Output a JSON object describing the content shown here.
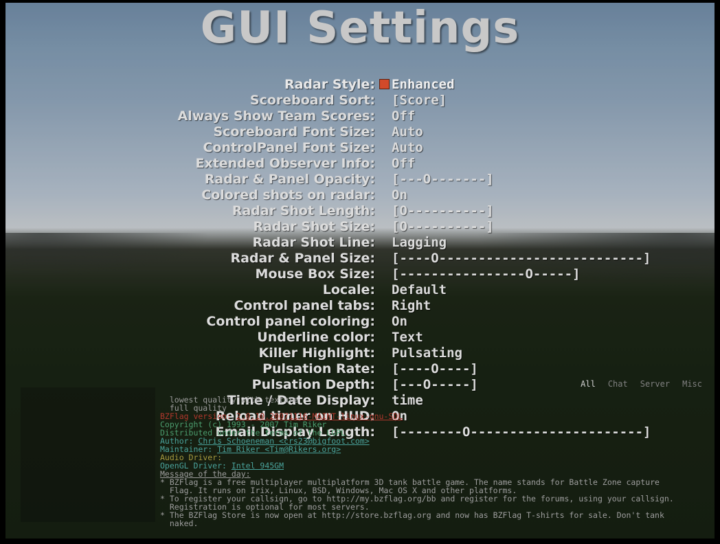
{
  "title": "GUI Settings",
  "menu": [
    {
      "label": "Radar Style:",
      "value": "Enhanced",
      "selected": true
    },
    {
      "label": "Scoreboard Sort:",
      "value": "[Score]"
    },
    {
      "label": "Always Show Team Scores:",
      "value": "Off"
    },
    {
      "label": "Scoreboard Font Size:",
      "value": "Auto"
    },
    {
      "label": "ControlPanel Font Size:",
      "value": "Auto"
    },
    {
      "label": "Extended Observer Info:",
      "value": "Off"
    },
    {
      "label": "Radar & Panel Opacity:",
      "value": "[---O-------]"
    },
    {
      "label": "Colored shots on radar:",
      "value": "On"
    },
    {
      "label": "Radar Shot Length:",
      "value": "[O----------]"
    },
    {
      "label": "Radar Shot Size:",
      "value": "[O----------]"
    },
    {
      "label": "Radar Shot Line:",
      "value": "Lagging"
    },
    {
      "label": "Radar & Panel Size:",
      "value": "[----O--------------------------]"
    },
    {
      "label": "Mouse Box Size:",
      "value": "[----------------O-----]"
    },
    {
      "label": "Locale:",
      "value": "Default"
    },
    {
      "label": "Control panel tabs:",
      "value": "Right"
    },
    {
      "label": "Control panel coloring:",
      "value": "On"
    },
    {
      "label": "Underline color:",
      "value": "Text"
    },
    {
      "label": "Killer Highlight:",
      "value": "Pulsating"
    },
    {
      "label": "Pulsation Rate:",
      "value": "[----O----]"
    },
    {
      "label": "Pulsation Depth:",
      "value": "[---O-----]"
    },
    {
      "label": "Time / Date Display:",
      "value": "time"
    },
    {
      "label": "Reload timer on HUD:",
      "value": "On"
    },
    {
      "label": "Email Display Length:",
      "value": "[--------O----------------------]"
    }
  ],
  "tabs": [
    "All",
    "Chat",
    "Server",
    "Misc"
  ],
  "tab_active": 0,
  "console": {
    "l0": "  lowest quality with texture",
    "l1": "  full quality",
    "l2a": "BZFlag version: ",
    "l2b": "2.0.10.20071116-MAINT-linux-gnu-SDL",
    "l3": "Copyright (c) 1993 - 2007 Tim Riker",
    "l4": "Distributed under the terms of the LGPL",
    "l5a": "Author: ",
    "l5b": "Chris Schoeneman <crs23@bigfoot.com>",
    "l6a": "Maintainer: ",
    "l6b": "Tim Riker <Tim@Rikers.org>",
    "l7": "Audio Driver:",
    "l8a": "OpenGL Driver: ",
    "l8b": "Intel 945GM",
    "l9": "Message of the day:",
    "l10": "* BZFlag is a free multiplayer multiplatform 3D tank battle game. The name stands for Battle Zone capture",
    "l11": "  Flag. It runs on Irix, Linux, BSD, Windows, Mac OS X and other platforms.",
    "l12": "* To register your callsign, go to http://my.bzflag.org/bb and register for the forums, using your callsign.",
    "l13": "  Registration is optional for most servers.",
    "l14": "* The BZFlag Store is now open at http://store.bzflag.org and now has BZFlag T-shirts for sale. Don't tank",
    "l15": "  naked."
  }
}
